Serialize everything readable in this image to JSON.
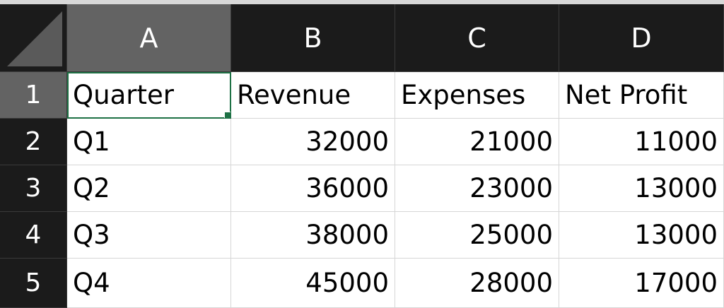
{
  "columns": [
    "A",
    "B",
    "C",
    "D"
  ],
  "rows": [
    "1",
    "2",
    "3",
    "4",
    "5"
  ],
  "cells": [
    [
      "Quarter",
      "Revenue",
      "Expenses",
      "Net Profit"
    ],
    [
      "Q1",
      "32000",
      "21000",
      "11000"
    ],
    [
      "Q2",
      "36000",
      "23000",
      "13000"
    ],
    [
      "Q3",
      "38000",
      "25000",
      "13000"
    ],
    [
      "Q4",
      "45000",
      "28000",
      "17000"
    ]
  ],
  "selected_cell": "A1",
  "colors": {
    "header_bg": "#1b1b1b",
    "header_selected_bg": "#636363",
    "selection_border": "#1e7145",
    "cell_bg": "#ffffff"
  }
}
